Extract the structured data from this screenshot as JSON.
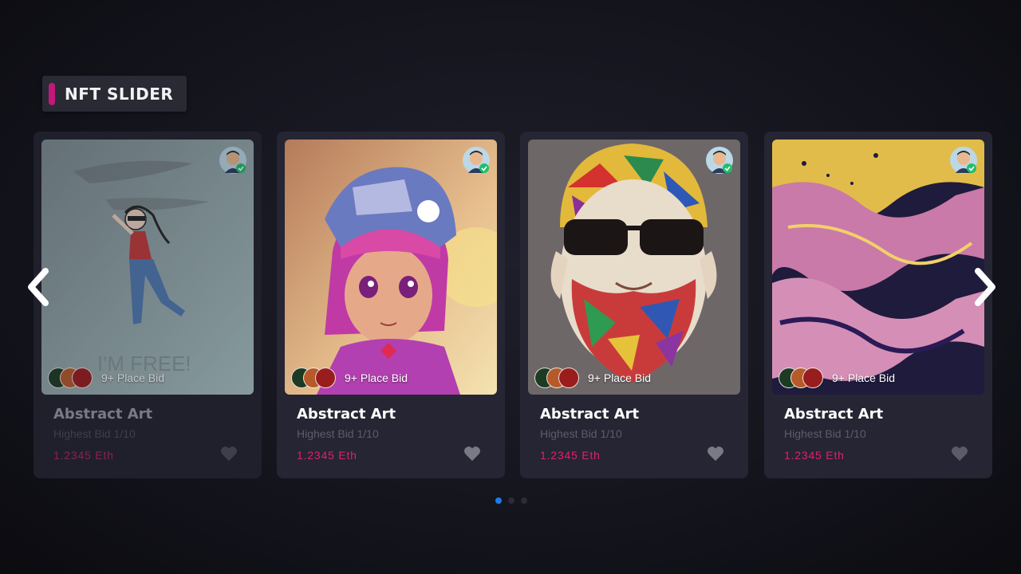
{
  "header": {
    "title": "NFT SLIDER"
  },
  "nav": {
    "prev_icon": "chevron-left-icon",
    "next_icon": "chevron-right-icon"
  },
  "colors": {
    "accent": "#c2187a",
    "price": "#e0216e",
    "active_dot": "#1e7ae8"
  },
  "cards": [
    {
      "art": "girl-sketch",
      "bid_label": "9+ Place Bid",
      "name": "Abstract Art",
      "sub": "Highest Bid 1/10",
      "price": "1.2345 Eth",
      "verified": true
    },
    {
      "art": "anime-girl",
      "bid_label": "9+ Place Bid",
      "name": "Abstract Art",
      "sub": "Highest Bid 1/10",
      "price": "1.2345 Eth",
      "verified": true
    },
    {
      "art": "mosaic-man",
      "bid_label": "9+ Place Bid",
      "name": "Abstract Art",
      "sub": "Highest Bid 1/10",
      "price": "1.2345 Eth",
      "verified": true
    },
    {
      "art": "fluid-marble",
      "bid_label": "9+ Place Bid",
      "name": "Abstract Art",
      "sub": "Highest Bid 1/10",
      "price": "1.2345 Eth",
      "verified": true
    }
  ],
  "pagination": {
    "count": 3,
    "active": 0
  }
}
